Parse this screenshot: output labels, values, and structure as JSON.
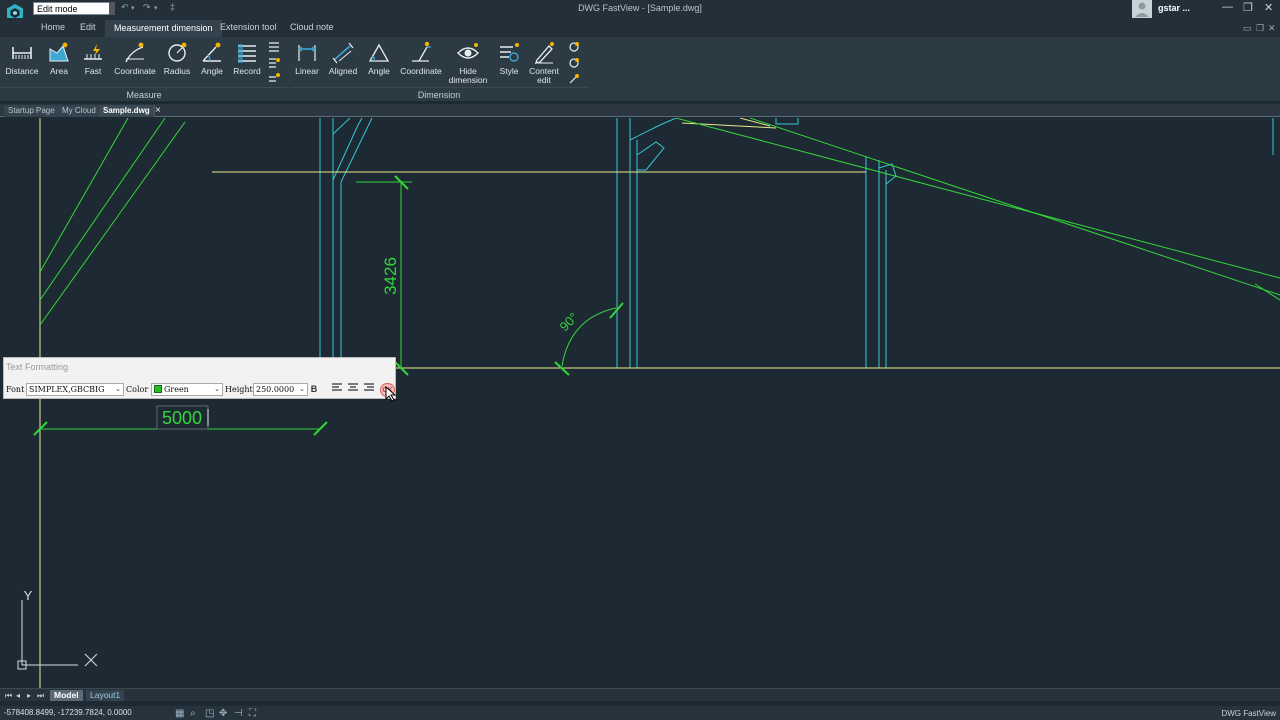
{
  "window": {
    "title": "DWG FastView - [Sample.dwg]",
    "mode": "Edit mode",
    "user": "gstar ...",
    "minimize": "—",
    "maximize": "❐",
    "close": "✕"
  },
  "ribbon_tabs": [
    {
      "label": "Home"
    },
    {
      "label": "Edit"
    },
    {
      "label": "Measurement dimension"
    },
    {
      "label": "Extension tool"
    },
    {
      "label": "Cloud note"
    }
  ],
  "measure_group": {
    "label": "Measure",
    "tools": [
      {
        "label": "Distance"
      },
      {
        "label": "Area"
      },
      {
        "label": "Fast"
      },
      {
        "label": "Coordinate"
      },
      {
        "label": "Radius"
      },
      {
        "label": "Angle"
      },
      {
        "label": "Record"
      }
    ]
  },
  "dimension_group": {
    "label": "Dimension",
    "tools": [
      {
        "label": "Linear"
      },
      {
        "label": "Aligned"
      },
      {
        "label": "Angle"
      },
      {
        "label": "Coordinate"
      },
      {
        "label": "Hide",
        "label2": "dimension"
      },
      {
        "label": "Style"
      },
      {
        "label": "Content",
        "label2": "edit"
      }
    ]
  },
  "doc_tabs": [
    {
      "label": "Startup Page"
    },
    {
      "label": "My Cloud"
    },
    {
      "label": "Sample.dwg"
    }
  ],
  "doc_close": "×",
  "drawing": {
    "dim_vertical": "3426",
    "dim_angle": "90°",
    "dim_edit_text": "5000",
    "axis_y": "Y",
    "colors": {
      "cyan": "#35c6d6",
      "yellow": "#e7e98a",
      "green": "#33d63a",
      "ucs": "#d8dde0"
    }
  },
  "text_formatting": {
    "title": "Text Formatting",
    "font_label": "Font",
    "font_value": "SIMPLEX,GBCBIG",
    "color_label": "Color",
    "color_value": "Green",
    "height_label": "Height",
    "height_value": "250.0000",
    "bold": "B",
    "ok": "OK"
  },
  "layout_tabs": [
    {
      "label": "Model"
    },
    {
      "label": "Layout1"
    }
  ],
  "status": {
    "coords": "-578408.8499, -17239.7824, 0.0000",
    "brand": "DWG FastView"
  }
}
